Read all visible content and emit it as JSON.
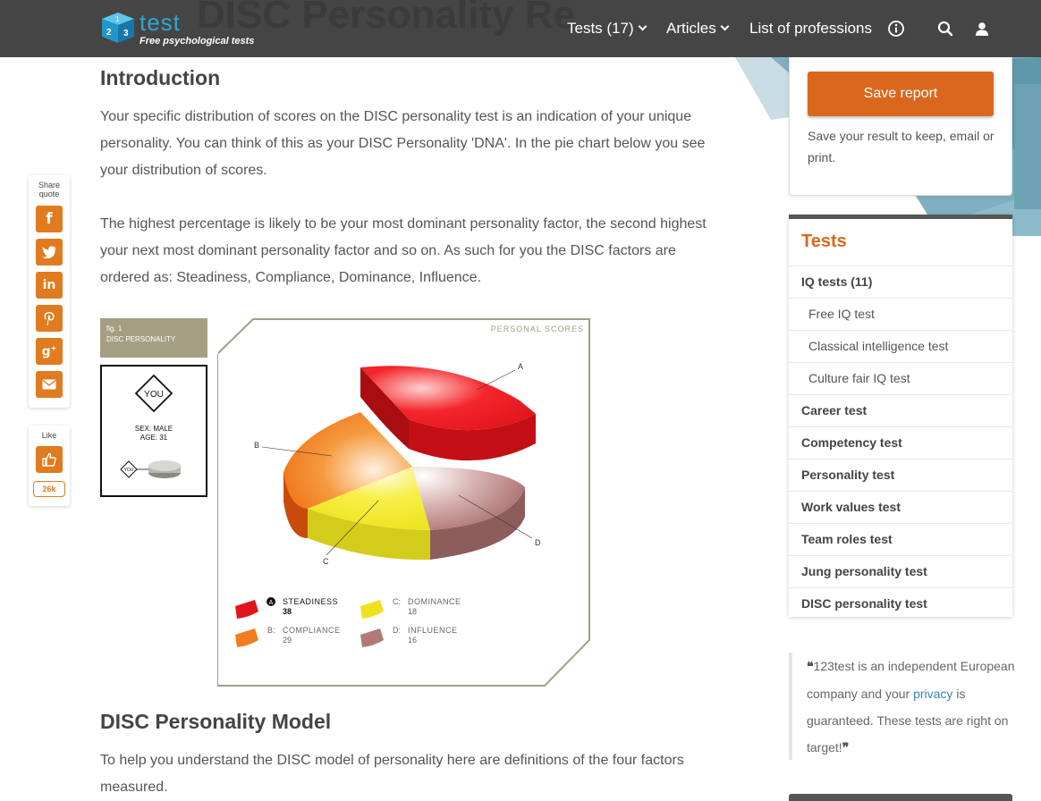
{
  "header": {
    "ghost_title": "DISC Personality Re",
    "logo_cube_digits": [
      "1",
      "2",
      "3"
    ],
    "logo_name": "test",
    "logo_tagline": "Free psychological tests",
    "nav": [
      {
        "label": "Tests (17)",
        "dropdown": true
      },
      {
        "label": "Articles",
        "dropdown": true
      },
      {
        "label": "List of professions",
        "dropdown": false
      }
    ],
    "icons": [
      "info-icon",
      "search-icon",
      "user-icon"
    ]
  },
  "share": {
    "label": "Share quote",
    "buttons": [
      "facebook-icon",
      "twitter-icon",
      "linkedin-icon",
      "pinterest-icon",
      "google-plus-icon",
      "email-icon"
    ],
    "like_label": "Like",
    "like_count": "26k"
  },
  "main": {
    "intro_heading": "Introduction",
    "intro_p1": "Your specific distribution of scores on the DISC personality test is an indication of your unique personality. You can think of this as your DISC Personality 'DNA'. In the pie chart below you see your distribution of scores.",
    "intro_p2": "The highest percentage is likely to be your most dominant personality factor, the second highest your next most dominant personality factor and so on. As such for you the DISC factors are ordered as: Steadiness, Compliance, Dominance, Influence.",
    "model_heading": "DISC Personality Model",
    "model_p": "To help you understand the DISC model of personality here are definitions of the four factors measured."
  },
  "figure": {
    "tag_line1": "fig. 1",
    "tag_line2": "DISC PERSONALITY",
    "you_label": "YOU",
    "sex": "SEX: MALE",
    "age": "AGE: 31",
    "small_you": "YOU",
    "panel_title": "PERSONAL SCORES",
    "slice_letters": [
      "A",
      "B",
      "C",
      "D"
    ],
    "legend": [
      {
        "letter": "A",
        "name": "STEADINESS",
        "value": "38",
        "color": "#e0151b"
      },
      {
        "letter": "C:",
        "name": "DOMINANCE",
        "value": "18",
        "color": "#f0e020"
      },
      {
        "letter": "B:",
        "name": "COMPLIANCE",
        "value": "29",
        "color": "#f07d20"
      },
      {
        "letter": "D:",
        "name": "INFLUENCE",
        "value": "16",
        "color": "#b07a78"
      }
    ]
  },
  "sidebar": {
    "save_button": "Save report",
    "save_text": "Save your result to keep, email or print.",
    "tests_title": "Tests",
    "tests_items": [
      {
        "label": "IQ tests (11)",
        "kind": "bold"
      },
      {
        "label": "Free IQ test",
        "kind": "sub"
      },
      {
        "label": "Classical intelligence test",
        "kind": "sub"
      },
      {
        "label": "Culture fair IQ test",
        "kind": "sub"
      },
      {
        "label": "Career test",
        "kind": "bold"
      },
      {
        "label": "Competency test",
        "kind": "bold"
      },
      {
        "label": "Personality test",
        "kind": "bold"
      },
      {
        "label": "Work values test",
        "kind": "bold"
      },
      {
        "label": "Team roles test",
        "kind": "bold"
      },
      {
        "label": "Jung personality test",
        "kind": "bold"
      },
      {
        "label": "DISC personality test",
        "kind": "bold"
      }
    ],
    "quote_open": "❝",
    "quote_part1": "123test is an independent European company and your ",
    "quote_link": "privacy",
    "quote_part2": " is guaranteed. These tests are right on target!",
    "quote_close": "❞"
  },
  "colors": {
    "accent": "#d9681e",
    "header_bg": "#454545",
    "share_orange": "#e07b1f"
  }
}
